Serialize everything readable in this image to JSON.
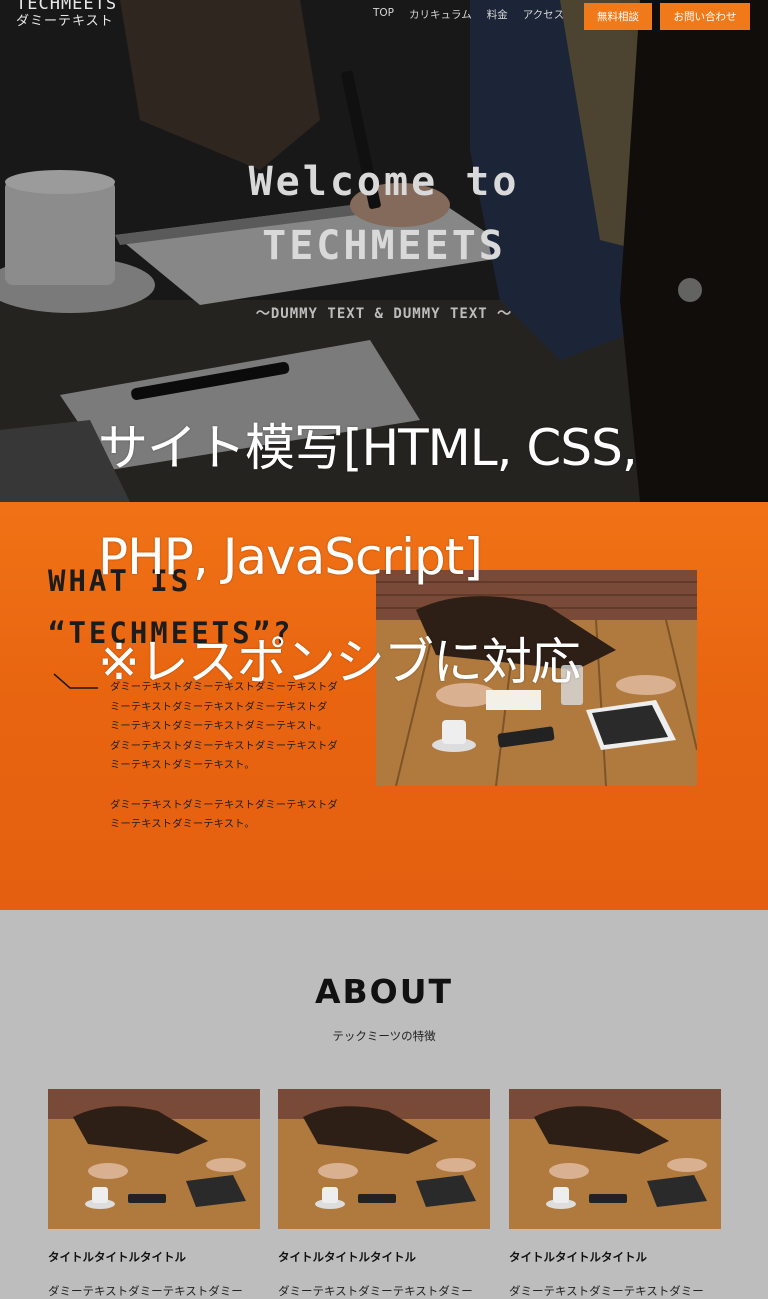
{
  "header": {
    "logo_line1": "TECHMEETS",
    "logo_line2": "ダミーテキスト",
    "nav": [
      "TOP",
      "カリキュラム",
      "料金",
      "アクセス"
    ],
    "btn_consult": "無料相談",
    "btn_contact": "お問い合わせ"
  },
  "hero": {
    "title_line1": "Welcome to",
    "title_line2": "TECHMEETS",
    "subtitle": "〜DUMMY TEXT & DUMMY TEXT 〜"
  },
  "what": {
    "heading_line1": "WHAT IS",
    "heading_line2": "“TECHMEETS”?",
    "para1_lines": [
      "ダミーテキストダミーテキストダミーテキストダ",
      "ミーテキストダミーテキストダミーテキストダ",
      "ミーテキストダミーテキストダミーテキスト。",
      "ダミーテキストダミーテキストダミーテキストダ",
      "ミーテキストダミーテキスト。"
    ],
    "para2_lines": [
      "ダミーテキストダミーテキストダミーテキストダ",
      "ミーテキストダミーテキスト。"
    ]
  },
  "about": {
    "title": "ABOUT",
    "subtitle": "テックミーツの特徴",
    "cards": [
      {
        "title": "タイトルタイトルタイトル",
        "body": "ダミーテキストダミーテキストダミー"
      },
      {
        "title": "タイトルタイトルタイトル",
        "body": "ダミーテキストダミーテキストダミー"
      },
      {
        "title": "タイトルタイトルタイトル",
        "body": "ダミーテキストダミーテキストダミー"
      }
    ]
  },
  "caption": {
    "line1": "サイト模写[HTML, CSS,",
    "line2": "PHP, JavaScript]",
    "line3": "※レスポンシブに対応"
  },
  "colors": {
    "accent": "#f07a1a",
    "orange_section": "#e86410",
    "about_bg": "#bdbdbd"
  }
}
